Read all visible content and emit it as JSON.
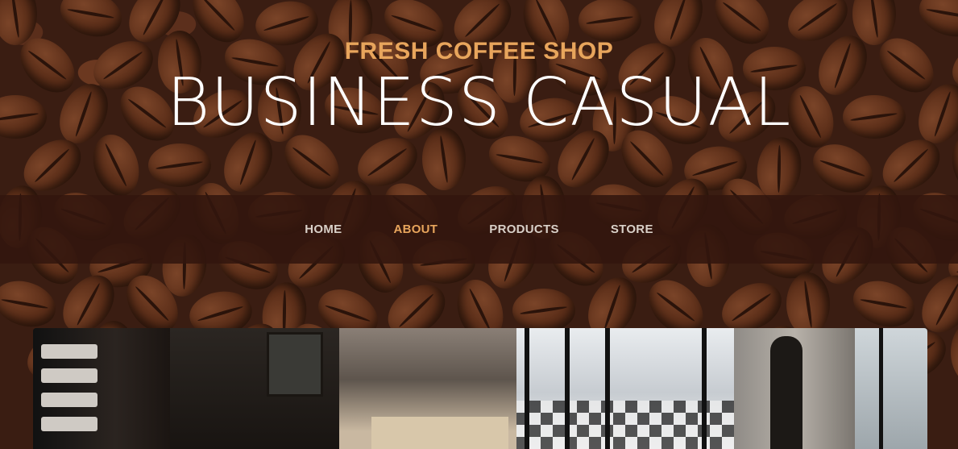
{
  "header": {
    "subheading": "FRESH COFFEE SHOP",
    "heading": "BUSINESS CASUAL"
  },
  "nav": {
    "items": [
      {
        "label": "HOME",
        "active": false
      },
      {
        "label": "ABOUT",
        "active": true
      },
      {
        "label": "PRODUCTS",
        "active": false
      },
      {
        "label": "STORE",
        "active": false
      }
    ]
  },
  "colors": {
    "accent": "#e8a55c",
    "nav_text": "#d9d0c8",
    "navbar_bg": "#32160e",
    "heading": "#ffffff"
  },
  "image": {
    "description": "coffee-shop-interior-photo"
  }
}
